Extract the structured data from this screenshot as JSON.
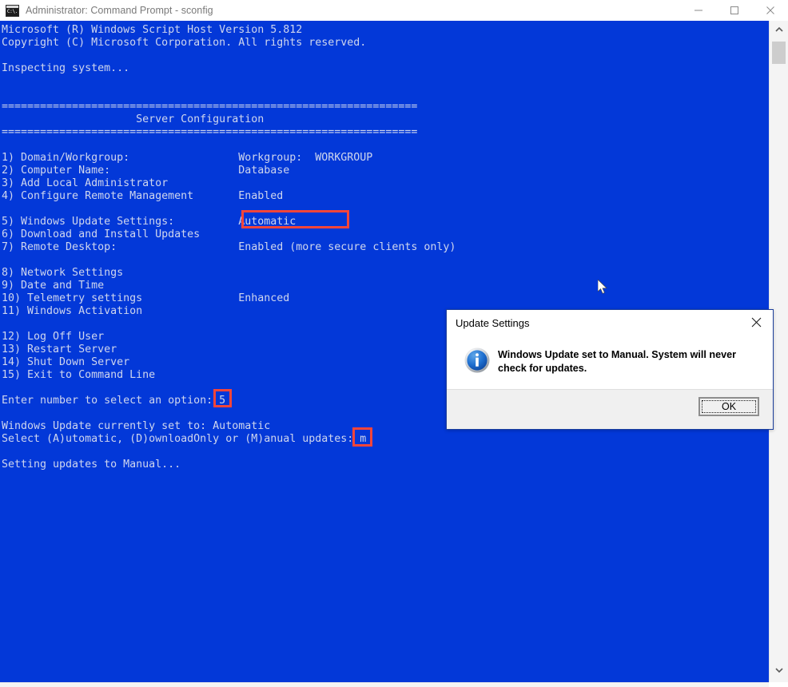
{
  "window": {
    "title": "Administrator: Command Prompt - sconfig",
    "icon": "console-icon",
    "minimize_label": "—",
    "maximize_label": "□",
    "close_label": "✕"
  },
  "colors": {
    "console_bg": "#0338d8",
    "console_fg": "#cfd6ee",
    "annotation_red": "#f4453a",
    "dialog_border": "#1c3f9b",
    "footer_bg": "#f0f0f0",
    "titlebar_text": "#7a7a7a"
  },
  "console": {
    "lines": [
      "Microsoft (R) Windows Script Host Version 5.812",
      "Copyright (C) Microsoft Corporation. All rights reserved.",
      "",
      "Inspecting system...",
      "",
      "",
      "=================================================================",
      "                     Server Configuration",
      "=================================================================",
      "",
      "1) Domain/Workgroup:                 Workgroup:  WORKGROUP",
      "2) Computer Name:                    Database",
      "3) Add Local Administrator",
      "4) Configure Remote Management       Enabled",
      "",
      "5) Windows Update Settings:          Automatic",
      "6) Download and Install Updates",
      "7) Remote Desktop:                   Enabled (more secure clients only)",
      "",
      "8) Network Settings",
      "9) Date and Time",
      "10) Telemetry settings               Enhanced",
      "11) Windows Activation",
      "",
      "12) Log Off User",
      "13) Restart Server",
      "14) Shut Down Server",
      "15) Exit to Command Line",
      "",
      "Enter number to select an option: 5",
      "",
      "Windows Update currently set to: Automatic",
      "Select (A)utomatic, (D)ownloadOnly or (M)anual updates: m",
      "",
      "Setting updates to Manual..."
    ],
    "menu": [
      {
        "number": "1)",
        "label": "Domain/Workgroup:",
        "value": "Workgroup:  WORKGROUP"
      },
      {
        "number": "2)",
        "label": "Computer Name:",
        "value": "Database"
      },
      {
        "number": "3)",
        "label": "Add Local Administrator",
        "value": ""
      },
      {
        "number": "4)",
        "label": "Configure Remote Management",
        "value": "Enabled"
      },
      {
        "number": "5)",
        "label": "Windows Update Settings:",
        "value": "Automatic"
      },
      {
        "number": "6)",
        "label": "Download and Install Updates",
        "value": ""
      },
      {
        "number": "7)",
        "label": "Remote Desktop:",
        "value": "Enabled (more secure clients only)"
      },
      {
        "number": "8)",
        "label": "Network Settings",
        "value": ""
      },
      {
        "number": "9)",
        "label": "Date and Time",
        "value": ""
      },
      {
        "number": "10)",
        "label": "Telemetry settings",
        "value": "Enhanced"
      },
      {
        "number": "11)",
        "label": "Windows Activation",
        "value": ""
      },
      {
        "number": "12)",
        "label": "Log Off User",
        "value": ""
      },
      {
        "number": "13)",
        "label": "Restart Server",
        "value": ""
      },
      {
        "number": "14)",
        "label": "Shut Down Server",
        "value": ""
      },
      {
        "number": "15)",
        "label": "Exit to Command Line",
        "value": ""
      }
    ],
    "header_title": "Server Configuration",
    "prompt_option_label": "Enter number to select an option:",
    "prompt_option_value": "5",
    "current_setting_line": "Windows Update currently set to: Automatic",
    "prompt_update_label": "Select (A)utomatic, (D)ownloadOnly or (M)anual updates:",
    "prompt_update_value": "m",
    "status_line": "Setting updates to Manual..."
  },
  "annotations": [
    {
      "name": "highlight-automatic-value",
      "target": "Automatic"
    },
    {
      "name": "highlight-option-input",
      "target": "5"
    },
    {
      "name": "highlight-update-input",
      "target": "m"
    }
  ],
  "dialog": {
    "title": "Update Settings",
    "close_label": "✕",
    "icon": "info-icon",
    "message": "Windows Update set to Manual.  System will never check for updates.",
    "ok_label": "OK"
  },
  "scrollbar": {
    "up_arrow": "⌃",
    "down_arrow": "⌄"
  }
}
